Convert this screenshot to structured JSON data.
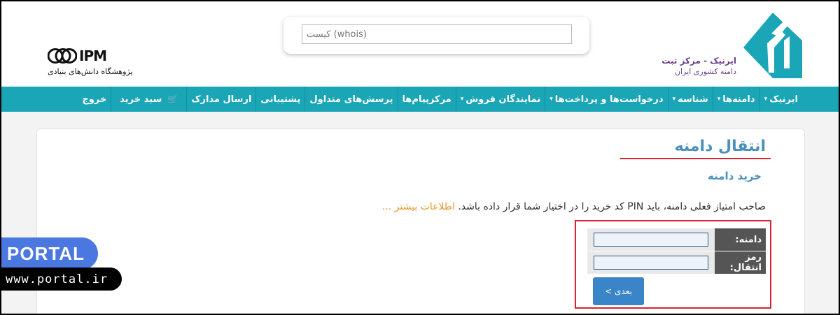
{
  "header": {
    "irnic_title": "ایرنیک - مرکز ثبت",
    "irnic_subtitle": "دامنه کشوری ایران",
    "whois_placeholder": "(whois) کیست",
    "ipm_text": "IPM",
    "ipm_subtitle": "پژوهشگاه دانش‌های بنیادی"
  },
  "nav": {
    "items": [
      {
        "label": "ایرنیک",
        "has_caret": true
      },
      {
        "label": "دامنه‌ها",
        "has_caret": true
      },
      {
        "label": "شناسه",
        "has_caret": true
      },
      {
        "label": "درخواست‌ها و پرداخت‌ها",
        "has_caret": true
      },
      {
        "label": "نمایندگان فروش",
        "has_caret": true
      },
      {
        "label": "مرکزپیام‌ها",
        "has_caret": false
      },
      {
        "label": "پرسش‌های متداول",
        "has_caret": false
      },
      {
        "label": "پشتیبانی",
        "has_caret": false
      },
      {
        "label": "ارسال مدارک",
        "has_caret": false
      },
      {
        "label": "سبد خرید",
        "has_caret": false,
        "icon": "cart-icon"
      },
      {
        "label": "خروج",
        "has_caret": false
      }
    ]
  },
  "main": {
    "title": "انتقال دامنه",
    "subtitle": "خرید دامنه",
    "description": "صاحب امتیاز فعلی دامنه، باید PIN کد خرید را در اختیار شما قرار داده باشد.",
    "more_link": "اطلاعات بیشتر ...",
    "form": {
      "domain_label": "دامنه:",
      "domain_value": "",
      "pin_label": "رمز انتقال:",
      "pin_value": "",
      "next_button": "بعدی >"
    }
  },
  "watermark": {
    "brand": "PORTAL",
    "url": "www.portal.ir"
  },
  "colors": {
    "nav_bg": "#1aa6b7",
    "title_color": "#4a90b8",
    "accent_red": "#d9232d",
    "link_orange": "#e39a2e",
    "button_blue": "#3a85c7"
  }
}
